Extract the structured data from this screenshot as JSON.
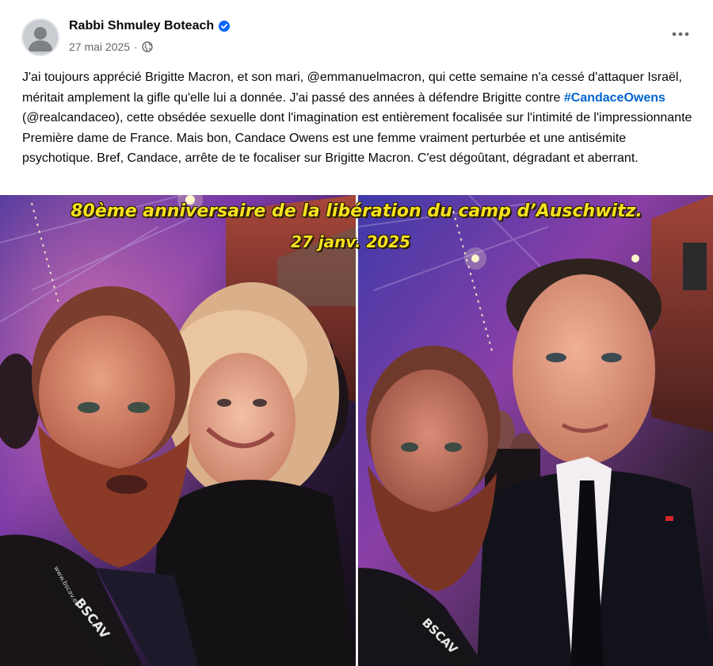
{
  "post": {
    "author_name": "Rabbi Shmuley Boteach",
    "date": "27 mai 2025",
    "separator": "·",
    "text_part1": "J'ai toujours apprécié Brigitte Macron, et son mari, @emmanuelmacron, qui cette semaine n'a cessé d'attaquer Israël, méritait amplement la gifle qu'elle lui a donnée. J'ai passé des années à défendre Brigitte contre ",
    "hashtag": "#CandaceOwens",
    "text_part2": " (@realcandaceo), cette obsédée sexuelle dont l'imagination est entièrement focalisée sur l'intimité de l'impressionnante Première dame de France. Mais bon, Candace Owens est une femme vraiment perturbée et une antisémite psychotique. Bref, Candace, arrête de te focaliser sur Brigitte Macron. C'est dégoûtant, dégradant et aberrant."
  },
  "icons": {
    "avatar": "default-profile-avatar",
    "verified": "verified-badge-icon",
    "audience": "globe-icon",
    "more": "more-options-icon"
  },
  "image_overlay": {
    "title": "80ème anniversaire de la libération du camp d’Auschwitz.",
    "date": "27 janv. 2025"
  },
  "lanyard_text": "BSCAV",
  "lanyard_small_text": "www.bscav.eu",
  "colors": {
    "hashtag": "#0064d1",
    "verified": "#0866ff",
    "overlay_text": "#f7e21f",
    "meta_text": "#65686c"
  }
}
